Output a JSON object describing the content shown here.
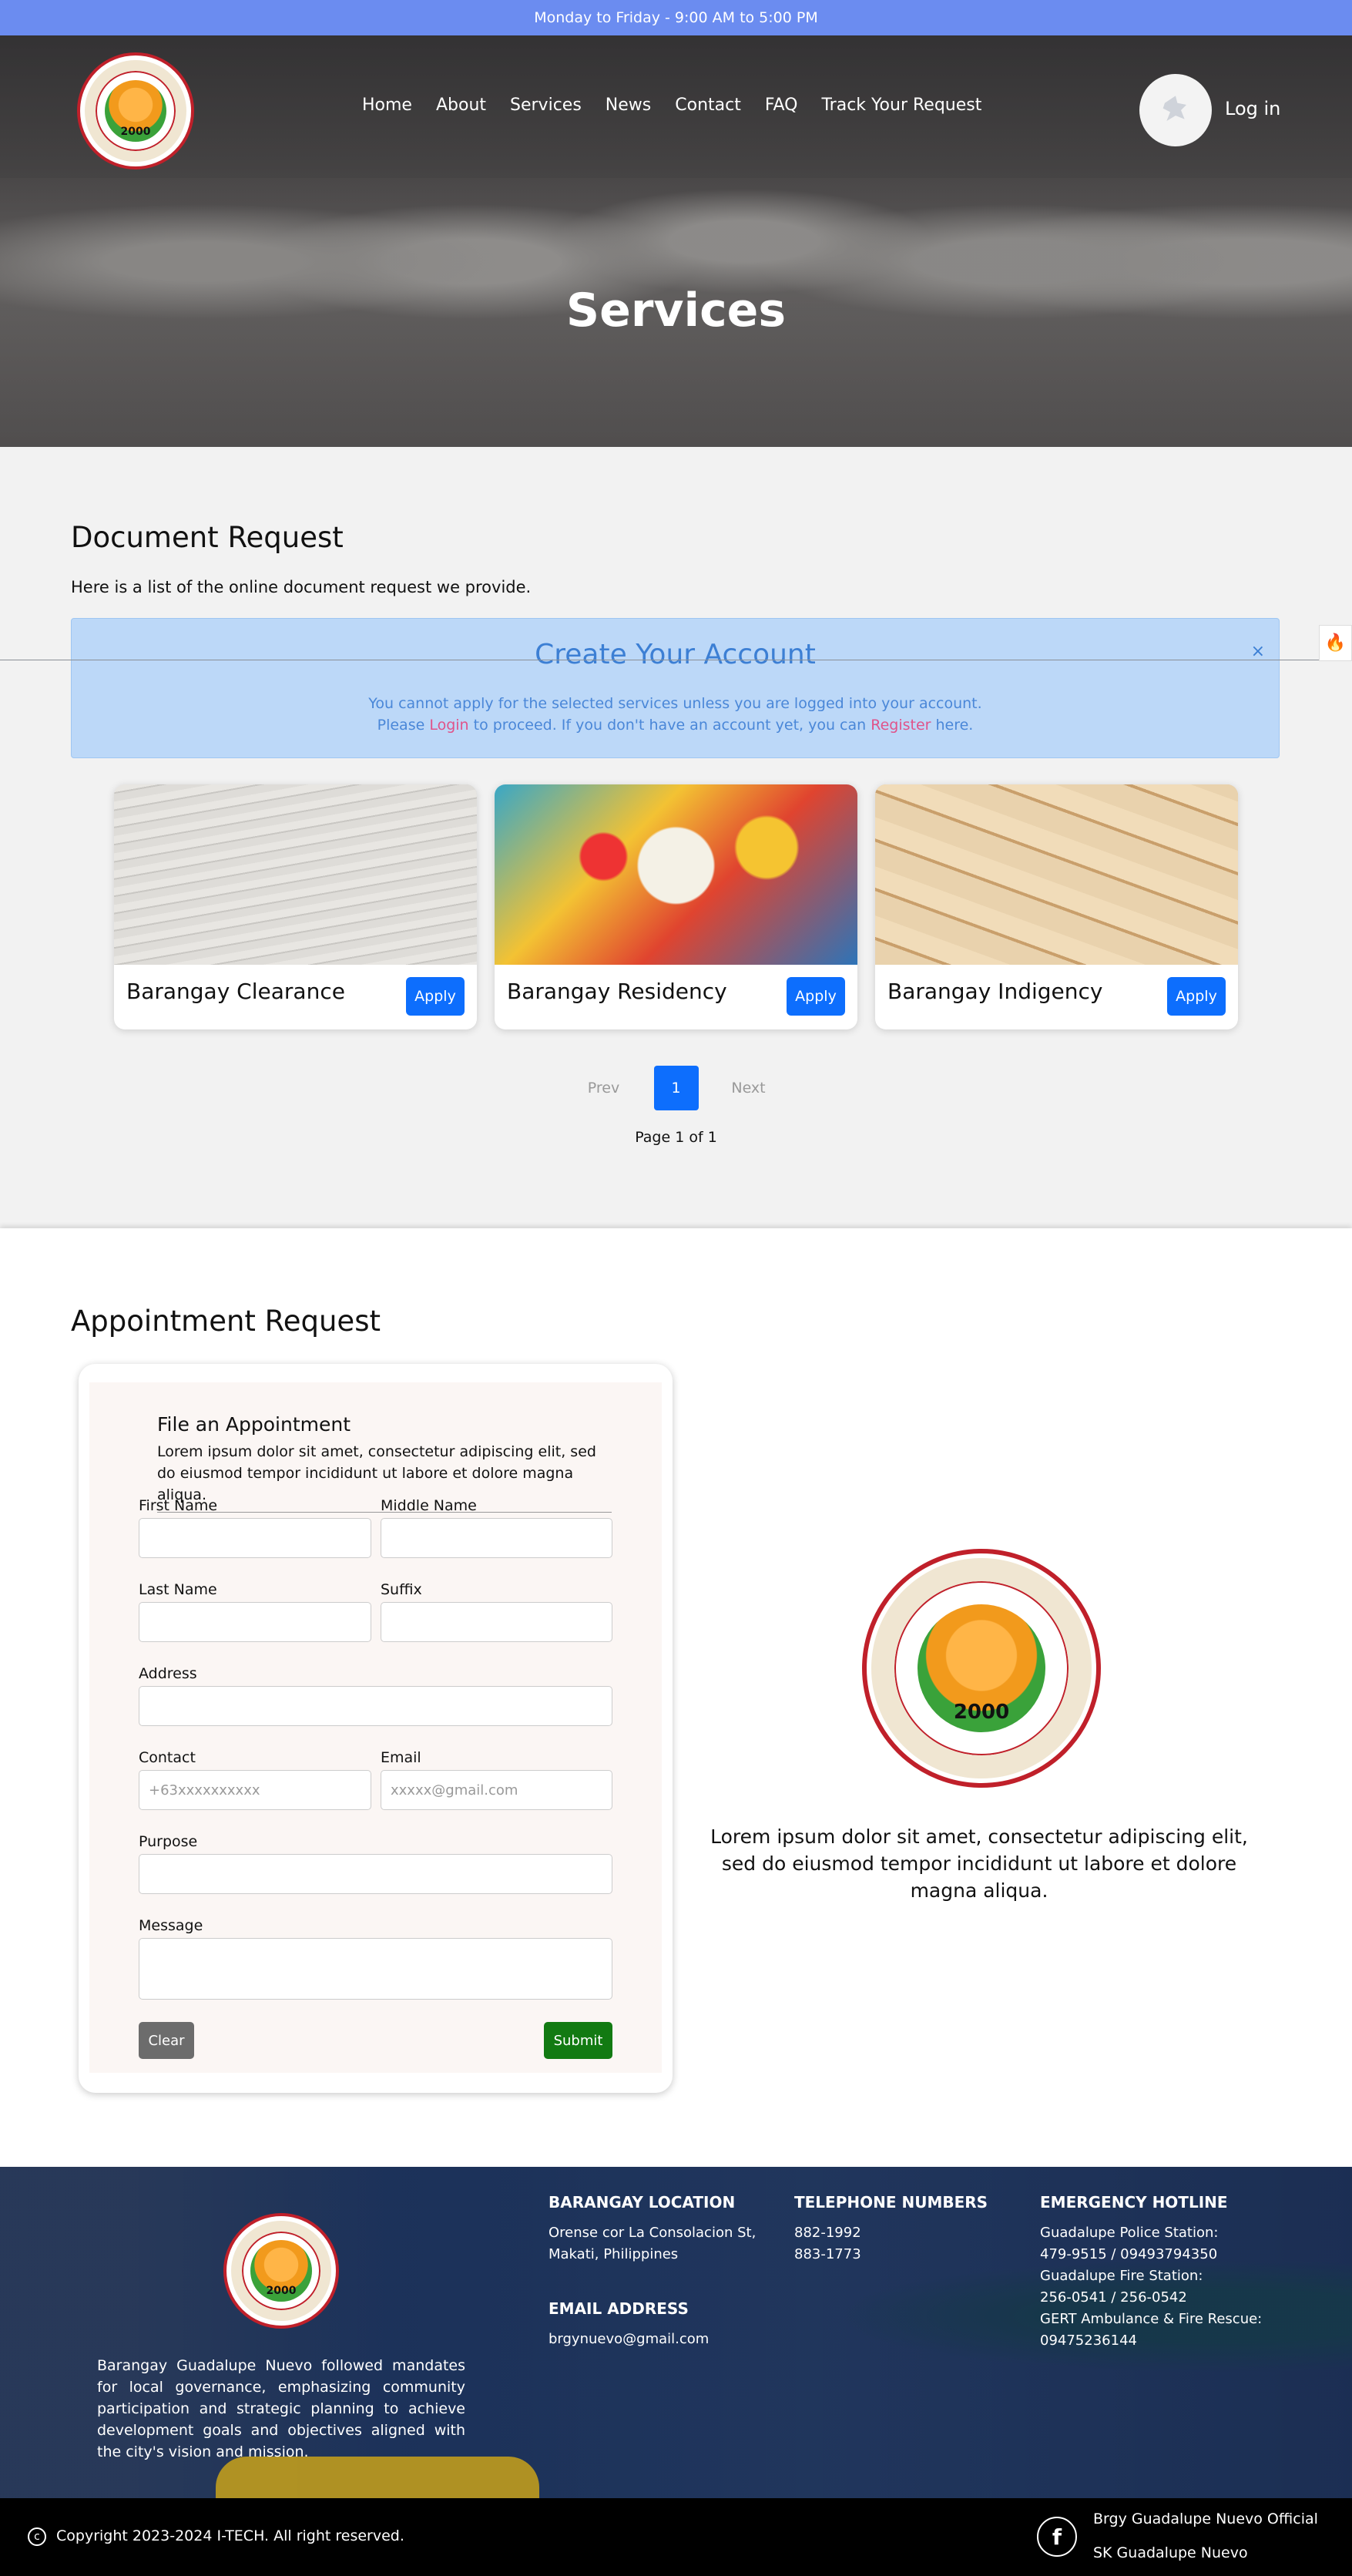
{
  "topbar": {
    "hours": "Monday to Friday - 9:00 AM to 5:00 PM"
  },
  "logo": {
    "year": "2000"
  },
  "nav": {
    "items": [
      "Home",
      "About",
      "Services",
      "News",
      "Contact",
      "FAQ",
      "Track Your Request"
    ],
    "login": "Log in"
  },
  "hero": {
    "title": "Services"
  },
  "document_request": {
    "title": "Document Request",
    "description": "Here is a list of the online document request we provide.",
    "alert": {
      "title": "Create Your Account",
      "line1": "You cannot apply for the selected services unless you are logged into your account.",
      "line2_a": "Please ",
      "login_link": "Login",
      "line2_b": " to proceed. If you don't have an account yet, you can ",
      "register_link": "Register",
      "line2_c": " here.",
      "close": "×"
    },
    "cards": [
      {
        "name": "Barangay Clearance",
        "button": "Apply"
      },
      {
        "name": "Barangay Residency",
        "button": "Apply"
      },
      {
        "name": "Barangay Indigency",
        "button": "Apply"
      }
    ],
    "pagination": {
      "prev": "Prev",
      "current": "1",
      "next": "Next",
      "info": "Page 1 of 1"
    }
  },
  "appointment": {
    "title": "Appointment Request",
    "form": {
      "heading": "File an Appointment",
      "description": "Lorem ipsum dolor sit amet, consectetur adipiscing elit, sed do eiusmod tempor incididunt ut labore et dolore magna aliqua.",
      "first_name": "First Name",
      "middle_name": "Middle Name",
      "last_name": "Last Name",
      "suffix": "Suffix",
      "address": "Address",
      "contact": "Contact",
      "contact_placeholder": "+63xxxxxxxxxx",
      "email": "Email",
      "email_placeholder": "xxxxx@gmail.com",
      "purpose": "Purpose",
      "message": "Message",
      "clear": "Clear",
      "submit": "Submit"
    },
    "side_text": "Lorem ipsum dolor sit amet, consectetur adipiscing elit, sed do eiusmod tempor incididunt ut labore et dolore magna aliqua."
  },
  "footer": {
    "about": "Barangay Guadalupe Nuevo followed mandates for local governance, emphasizing community participation and strategic planning to achieve development goals and objectives aligned with the city's vision and mission.",
    "location_heading": "BARANGAY LOCATION",
    "location": [
      "Orense cor La Consolacion St,",
      "Makati, Philippines"
    ],
    "email_heading": "EMAIL ADDRESS",
    "email": "brgynuevo@gmail.com",
    "telephone_heading": "TELEPHONE NUMBERS",
    "telephone": [
      "882-1992",
      "883-1773"
    ],
    "hotline_heading": "EMERGENCY HOTLINE",
    "hotline": [
      "Guadalupe Police Station:",
      "479-9515 / 09493794350",
      "Guadalupe Fire Station:",
      "256-0541 / 256-0542",
      "GERT Ambulance & Fire Rescue:",
      "09475236144"
    ],
    "copyright": "Copyright 2023-2024 I-TECH. All right reserved.",
    "social": [
      "Brgy Guadalupe Nuevo Official",
      "SK Guadalupe Nuevo"
    ]
  }
}
